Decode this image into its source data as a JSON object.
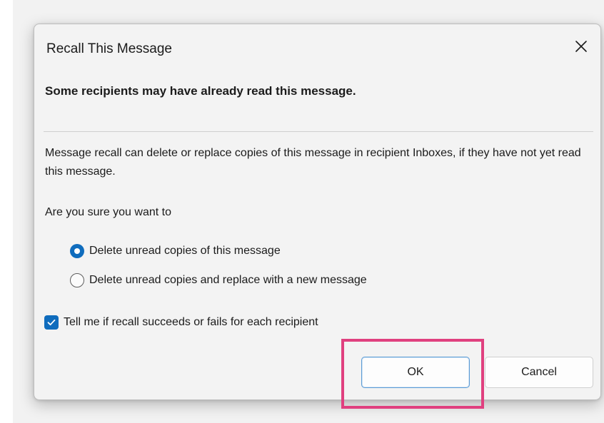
{
  "dialog": {
    "title": "Recall This Message",
    "heading": "Some recipients may have already read this message.",
    "description": "Message recall can delete or replace copies of this message in recipient Inboxes, if they have not yet read this message.",
    "question": "Are you sure you want to",
    "options": [
      {
        "label": "Delete unread copies of this message",
        "selected": true
      },
      {
        "label": "Delete unread copies and replace with a new message",
        "selected": false
      }
    ],
    "checkbox": {
      "label": "Tell me if recall succeeds or fails for each recipient",
      "checked": true
    },
    "buttons": {
      "ok": "OK",
      "cancel": "Cancel"
    }
  },
  "icons": {
    "close": "close-icon",
    "check": "checkmark-icon"
  },
  "colors": {
    "accent": "#0f6cbd",
    "highlight": "#e0407f",
    "ok_border": "#5b9bd5"
  }
}
